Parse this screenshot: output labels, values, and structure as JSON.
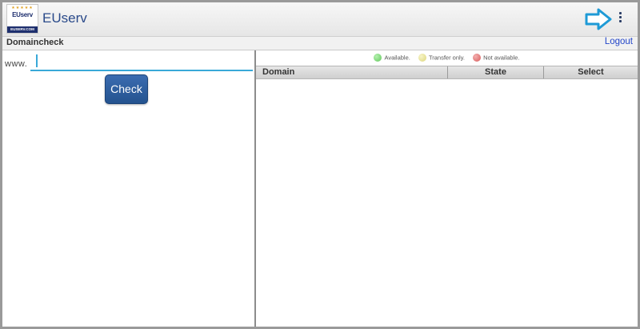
{
  "app": {
    "title": "EUserv",
    "logo": {
      "stars": "★★★★★",
      "text": "EUserv",
      "bar": "EUSERV.COM"
    }
  },
  "icons": {
    "hint_arrow": "arrow-right-icon",
    "overflow_menu": "overflow-menu-icon"
  },
  "header": {
    "section_title": "Domaincheck",
    "logout_label": "Logout"
  },
  "form": {
    "prefix_label": "www.",
    "domain_value": "",
    "check_label": "Check"
  },
  "legend": [
    {
      "label": "Available.",
      "color": "#7ed47a"
    },
    {
      "label": "Transfer only.",
      "color": "#e8e49a"
    },
    {
      "label": "Not available.",
      "color": "#e07a7a"
    }
  ],
  "table": {
    "columns": [
      "Domain",
      "State",
      "Select"
    ],
    "rows": []
  },
  "colors": {
    "accent": "#39a9d8",
    "button": "#2b5fa0",
    "link": "#2346c9"
  }
}
